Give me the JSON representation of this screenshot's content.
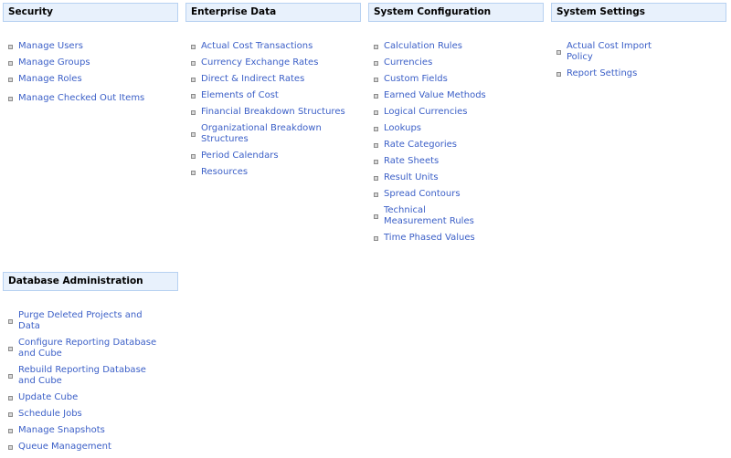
{
  "sections": [
    {
      "id": "security",
      "title": "Security",
      "items": [
        {
          "label": "Manage Users"
        },
        {
          "label": "Manage Groups"
        },
        {
          "label": "Manage Roles"
        },
        {
          "label": "Manage Checked Out Items",
          "gap": true
        }
      ]
    },
    {
      "id": "enterprise-data",
      "title": "Enterprise Data",
      "items": [
        {
          "label": "Actual Cost Transactions"
        },
        {
          "label": "Currency Exchange Rates"
        },
        {
          "label": "Direct & Indirect Rates"
        },
        {
          "label": "Elements of Cost"
        },
        {
          "label": "Financial Breakdown Structures"
        },
        {
          "label": "Organizational Breakdown Structures"
        },
        {
          "label": "Period Calendars"
        },
        {
          "label": "Resources"
        }
      ]
    },
    {
      "id": "system-configuration",
      "title": "System Configuration",
      "items": [
        {
          "label": "Calculation Rules"
        },
        {
          "label": "Currencies"
        },
        {
          "label": "Custom Fields"
        },
        {
          "label": "Earned Value Methods"
        },
        {
          "label": "Logical Currencies"
        },
        {
          "label": "Lookups"
        },
        {
          "label": "Rate Categories"
        },
        {
          "label": "Rate Sheets"
        },
        {
          "label": "Result Units"
        },
        {
          "label": "Spread Contours"
        },
        {
          "label": "Technical Measurement Rules"
        },
        {
          "label": "Time Phased Values"
        }
      ]
    },
    {
      "id": "system-settings",
      "title": "System Settings",
      "items": [
        {
          "label": "Actual Cost Import Policy"
        },
        {
          "label": "Report Settings"
        }
      ]
    },
    {
      "id": "database-administration",
      "title": "Database Administration",
      "items": [
        {
          "label": "Purge Deleted Projects and Data"
        },
        {
          "label": "Configure Reporting Database and Cube"
        },
        {
          "label": "Rebuild Reporting Database and Cube"
        },
        {
          "label": "Update Cube"
        },
        {
          "label": "Schedule Jobs"
        },
        {
          "label": "Manage Snapshots"
        },
        {
          "label": "Queue Management"
        }
      ]
    }
  ]
}
